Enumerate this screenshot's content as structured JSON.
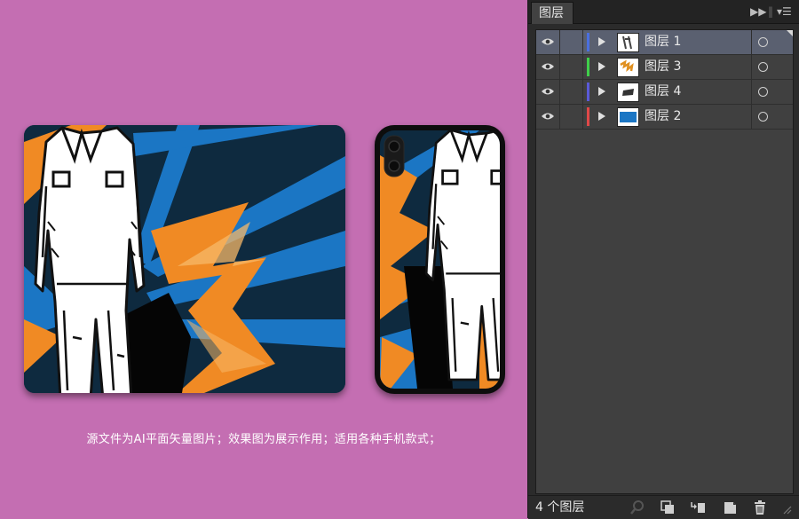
{
  "caption": "源文件为AI平面矢量图片；效果图为展示作用；适用各种手机款式；",
  "panel": {
    "tab_label": "图层",
    "layers": [
      {
        "name": "图层 1",
        "color": "#4a6fe0",
        "selected": true
      },
      {
        "name": "图层 3",
        "color": "#3fcf4a",
        "selected": false
      },
      {
        "name": "图层 4",
        "color": "#5a5ad8",
        "selected": false
      },
      {
        "name": "图层 2",
        "color": "#e04848",
        "selected": false
      }
    ],
    "footer": {
      "layer_count": "4 个图层"
    }
  },
  "colors": {
    "background": "#c46eb2",
    "art_navy": "#0e2a3f",
    "art_blue": "#1b76c4",
    "art_orange": "#f08a24",
    "art_orange_light": "#f7b868"
  }
}
